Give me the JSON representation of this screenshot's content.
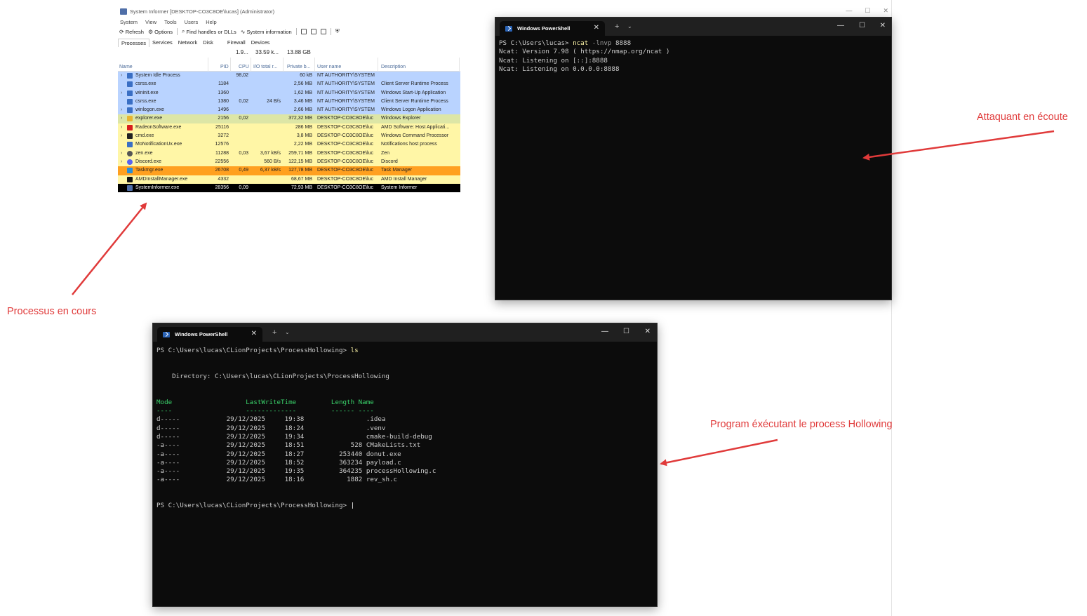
{
  "system_informer": {
    "title": "System Informer [DESKTOP-CO3C8OE\\lucas] (Administrator)",
    "window_controls": [
      "—",
      "☐",
      "✕"
    ],
    "menu": [
      "System",
      "View",
      "Tools",
      "Users",
      "Help"
    ],
    "toolbar": {
      "refresh": "Refresh",
      "options": "Options",
      "find": "Find handles or DLLs",
      "sysinfo": "System information"
    },
    "tabs": [
      "Processes",
      "Services",
      "Network",
      "Disk",
      "Firewall",
      "Devices"
    ],
    "summary": {
      "cpu": "1.9...",
      "io": "33.59 k...",
      "private": "13.88 GB"
    },
    "columns": {
      "name": "Name",
      "pid": "PID",
      "cpu": "CPU",
      "io": "I/O total r...",
      "private": "Private b...",
      "user": "User name",
      "description": "Description"
    },
    "processes": [
      {
        "name": "System Idle Process",
        "pid": "",
        "cpu": "98,02",
        "io": "",
        "private": "60 kB",
        "user": "NT AUTHORITY\\SYSTEM",
        "description": "",
        "expand": "›",
        "icon": "window-icon",
        "bg": "#b9d3ff"
      },
      {
        "name": "csrss.exe",
        "pid": "1184",
        "cpu": "",
        "io": "",
        "private": "2,56 MB",
        "user": "NT AUTHORITY\\SYSTEM",
        "description": "Client Server Runtime Process",
        "expand": "",
        "icon": "window-icon",
        "bg": "#b9d3ff"
      },
      {
        "name": "wininit.exe",
        "pid": "1360",
        "cpu": "",
        "io": "",
        "private": "1,62 MB",
        "user": "NT AUTHORITY\\SYSTEM",
        "description": "Windows Start-Up Application",
        "expand": "›",
        "icon": "window-icon",
        "bg": "#b9d3ff"
      },
      {
        "name": "csrss.exe",
        "pid": "1380",
        "cpu": "0,02",
        "io": "24 B/s",
        "private": "3,46 MB",
        "user": "NT AUTHORITY\\SYSTEM",
        "description": "Client Server Runtime Process",
        "expand": "",
        "icon": "window-icon",
        "bg": "#b9d3ff"
      },
      {
        "name": "winlogon.exe",
        "pid": "1496",
        "cpu": "",
        "io": "",
        "private": "2,66 MB",
        "user": "NT AUTHORITY\\SYSTEM",
        "description": "Windows Logon Application",
        "expand": "›",
        "icon": "window-icon",
        "bg": "#b9d3ff"
      },
      {
        "name": "explorer.exe",
        "pid": "2156",
        "cpu": "0,02",
        "io": "",
        "private": "372,32 MB",
        "user": "DESKTOP-CO3C8OE\\luc",
        "description": "Windows Explorer",
        "expand": "›",
        "icon": "folder-icon",
        "bg": "#dde6a6"
      },
      {
        "name": "RadeonSoftware.exe",
        "pid": "25116",
        "cpu": "",
        "io": "",
        "private": "286 MB",
        "user": "DESKTOP-CO3C8OE\\luc",
        "description": "AMD Software: Host Applicati...",
        "expand": "›",
        "icon": "amd-radeon-icon",
        "bg": "#fff6a6"
      },
      {
        "name": "cmd.exe",
        "pid": "3272",
        "cpu": "",
        "io": "",
        "private": "3,8 MB",
        "user": "DESKTOP-CO3C8OE\\luc",
        "description": "Windows Command Processor",
        "expand": "›",
        "icon": "console-icon",
        "bg": "#fff6a6"
      },
      {
        "name": "MoNotificationUx.exe",
        "pid": "12576",
        "cpu": "",
        "io": "",
        "private": "2,22 MB",
        "user": "DESKTOP-CO3C8OE\\luc",
        "description": "Notifications host process",
        "expand": "",
        "icon": "window-icon",
        "bg": "#fff6a6"
      },
      {
        "name": "zen.exe",
        "pid": "11288",
        "cpu": "0,03",
        "io": "3,67 kB/s",
        "private": "259,71 MB",
        "user": "DESKTOP-CO3C8OE\\luc",
        "description": "Zen",
        "expand": "›",
        "icon": "zen-browser-icon",
        "bg": "#fff6a6"
      },
      {
        "name": "Discord.exe",
        "pid": "22556",
        "cpu": "",
        "io": "560 B/s",
        "private": "122,15 MB",
        "user": "DESKTOP-CO3C8OE\\luc",
        "description": "Discord",
        "expand": "›",
        "icon": "discord-icon",
        "bg": "#fff6a6"
      },
      {
        "name": "Taskmgr.exe",
        "pid": "26708",
        "cpu": "0,49",
        "io": "6,37 kB/s",
        "private": "127,78 MB",
        "user": "DESKTOP-CO3C8OE\\luc",
        "description": "Task Manager",
        "expand": "",
        "icon": "task-manager-icon",
        "bg": "#ffa020"
      },
      {
        "name": "AMDInstallManager.exe",
        "pid": "4332",
        "cpu": "",
        "io": "",
        "private": "68,67 MB",
        "user": "DESKTOP-CO3C8OE\\luc",
        "description": "AMD Install Manager",
        "expand": "",
        "icon": "amd-icon",
        "bg": "#fff6a6"
      },
      {
        "name": "SystemInformer.exe",
        "pid": "28356",
        "cpu": "0,09",
        "io": "",
        "private": "72,93 MB",
        "user": "DESKTOP-CO3C8OE\\luc",
        "description": "System Informer",
        "expand": "",
        "icon": "system-informer-icon",
        "bg": "#000000",
        "fg": "#ffffff"
      }
    ]
  },
  "ps_attacker": {
    "tab_title": "Windows PowerShell",
    "lines": [
      {
        "prompt": "PS C:\\Users\\lucas> ",
        "cmd": "ncat",
        "args": " -lnvp ",
        "rest": "8888"
      },
      {
        "text": "Ncat: Version 7.98 ( https://nmap.org/ncat )"
      },
      {
        "text": "Ncat: Listening on [::]:8888"
      },
      {
        "text": "Ncat: Listening on 0.0.0.0:8888"
      }
    ]
  },
  "ps_program": {
    "tab_title": "Windows PowerShell",
    "prompt1": "PS C:\\Users\\lucas\\CLionProjects\\ProcessHollowing> ",
    "cmd1": "ls",
    "directory": "    Directory: C:\\Users\\lucas\\CLionProjects\\ProcessHollowing",
    "headers": {
      "mode": "Mode",
      "time": "LastWriteTime",
      "length": "Length",
      "name": "Name"
    },
    "underline": {
      "mode": "----",
      "time": "-------------",
      "length": "------",
      "name": "----"
    },
    "files": [
      {
        "mode": "d-----",
        "date": "29/12/2025",
        "time": "19:38",
        "length": "",
        "name": ".idea"
      },
      {
        "mode": "d-----",
        "date": "29/12/2025",
        "time": "18:24",
        "length": "",
        "name": ".venv"
      },
      {
        "mode": "d-----",
        "date": "29/12/2025",
        "time": "19:34",
        "length": "",
        "name": "cmake-build-debug"
      },
      {
        "mode": "-a----",
        "date": "29/12/2025",
        "time": "18:51",
        "length": "528",
        "name": "CMakeLists.txt"
      },
      {
        "mode": "-a----",
        "date": "29/12/2025",
        "time": "18:27",
        "length": "253440",
        "name": "donut.exe"
      },
      {
        "mode": "-a----",
        "date": "29/12/2025",
        "time": "18:52",
        "length": "363234",
        "name": "payload.c"
      },
      {
        "mode": "-a----",
        "date": "29/12/2025",
        "time": "19:35",
        "length": "364235",
        "name": "processHollowing.c"
      },
      {
        "mode": "-a----",
        "date": "29/12/2025",
        "time": "18:16",
        "length": "1882",
        "name": "rev_sh.c"
      }
    ],
    "prompt2": "PS C:\\Users\\lucas\\CLionProjects\\ProcessHollowing> ",
    "cursor": "|"
  },
  "ps_common": {
    "close_tab": "✕",
    "new_tab": "+",
    "dropdown": "⌄",
    "minimize": "—",
    "maximize": "☐",
    "close": "✕"
  },
  "annotations": {
    "processes": "Processus en cours",
    "attacker": "Attaquant en écoute",
    "program": "Program éxécutant le process Hollowing",
    "color": "#e03a3a"
  }
}
